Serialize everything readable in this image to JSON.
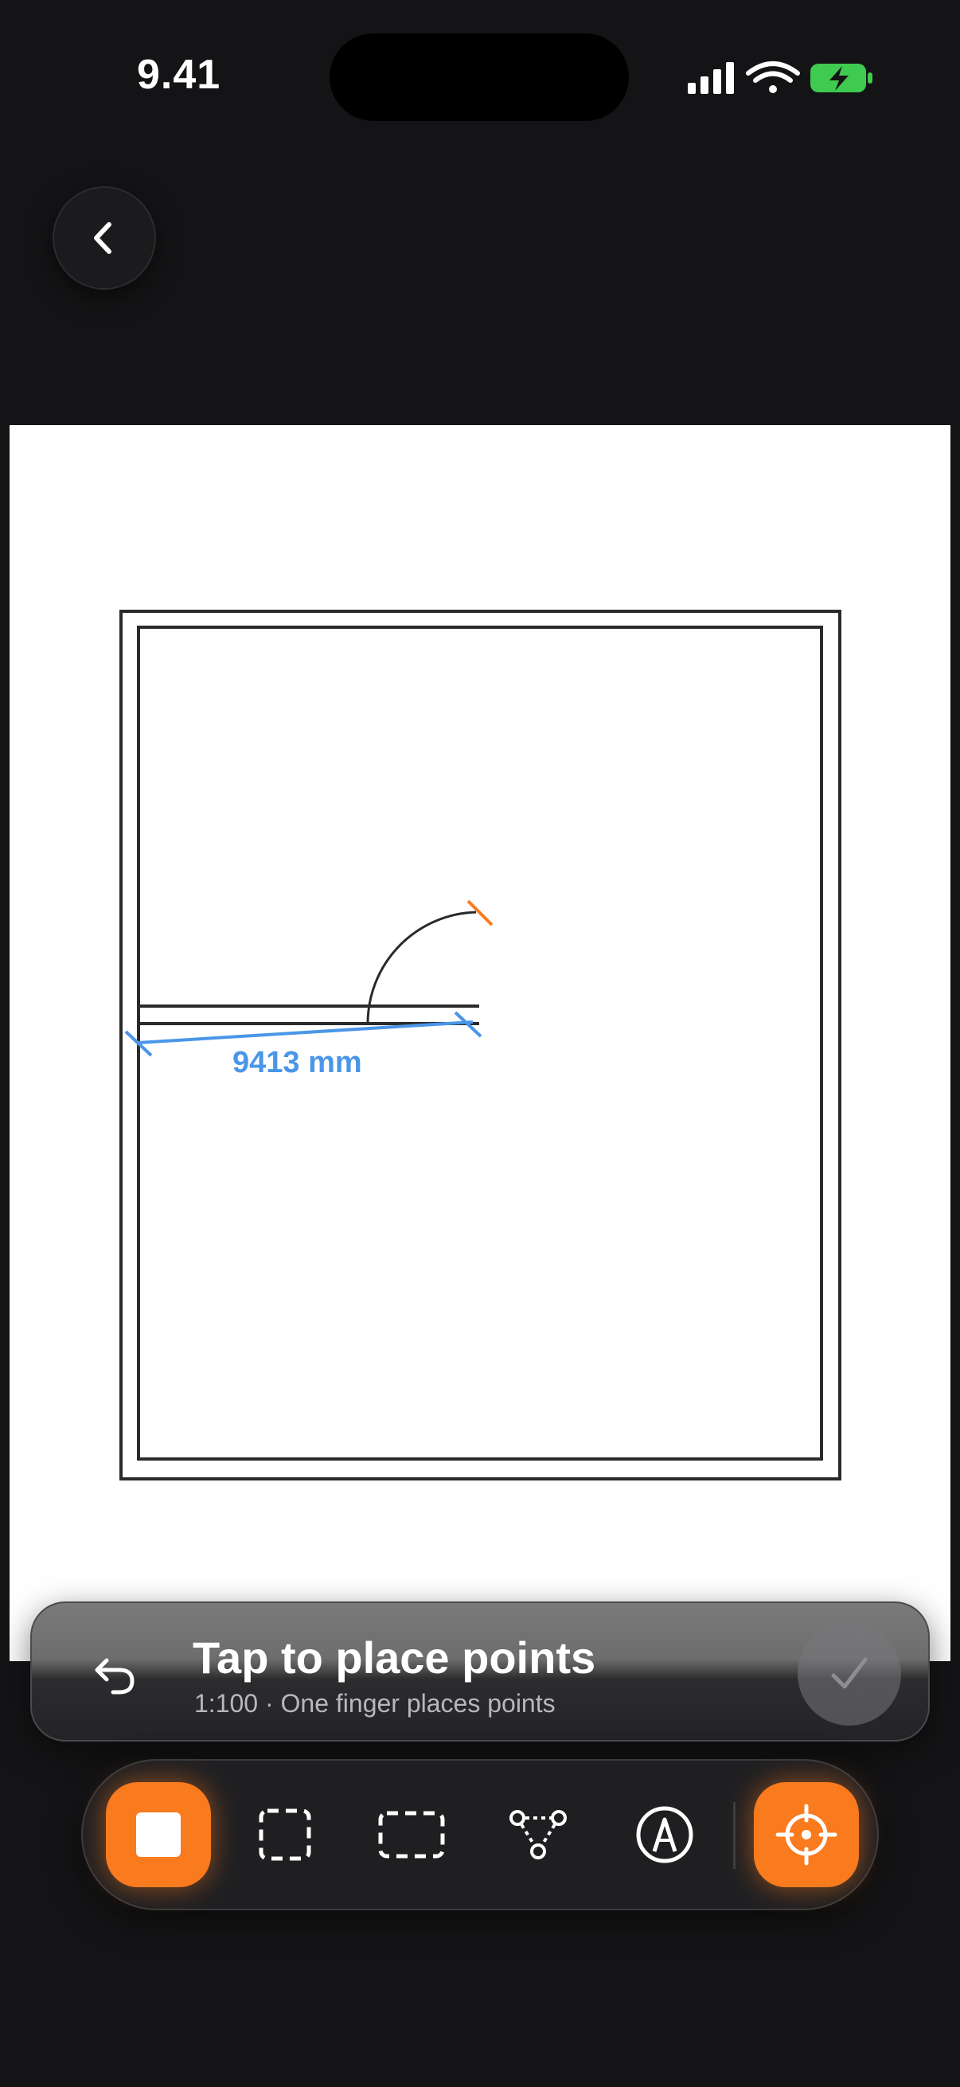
{
  "status_bar": {
    "time": "9.41"
  },
  "colors": {
    "accent": "#fa7a1e",
    "measure": "#4a96e8",
    "battery": "#3fca50",
    "background": "#141416",
    "canvas": "#ffffff"
  },
  "navigation": {
    "back_icon": "chevron-left-icon"
  },
  "drawing": {
    "measurement_label": "9413 mm"
  },
  "hint": {
    "title": "Tap to place points",
    "subtitle": "1:100 · One finger places points",
    "undo_icon": "undo-arrow-icon",
    "confirm_icon": "checkmark-icon"
  },
  "toolbar": {
    "tools": [
      {
        "id": "solid-rectangle",
        "icon": "filled-square-icon",
        "active": true
      },
      {
        "id": "dashed-square",
        "icon": "dashed-square-icon",
        "active": false
      },
      {
        "id": "dashed-rectangle",
        "icon": "dashed-rectangle-icon",
        "active": false
      },
      {
        "id": "polygon-points",
        "icon": "polygon-nodes-icon",
        "active": false
      },
      {
        "id": "annotate",
        "icon": "pen-circle-icon",
        "active": false
      },
      {
        "id": "snap-target",
        "icon": "crosshair-icon",
        "active": true
      }
    ]
  }
}
